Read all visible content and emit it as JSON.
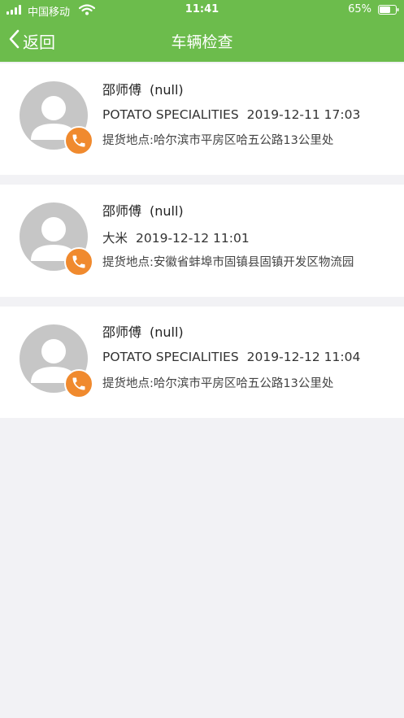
{
  "status_bar": {
    "carrier": "中国移动",
    "time": "11:41",
    "battery": "65%"
  },
  "header": {
    "back_label": "返回",
    "title": "车辆检查"
  },
  "colors": {
    "header_bg": "#6cbc4c",
    "phone_badge": "#f08a2e",
    "avatar_bg": "#c6c6c6",
    "page_bg": "#f2f2f5"
  },
  "records": [
    {
      "driver": "邵师傅",
      "phone": "(null)",
      "goods": "POTATO SPECIALITIES",
      "datetime": "2019-12-11 17:03",
      "pickup": "提货地点:哈尔滨市平房区哈五公路13公里处"
    },
    {
      "driver": "邵师傅",
      "phone": "(null)",
      "goods": "大米",
      "datetime": "2019-12-12 11:01",
      "pickup": "提货地点:安徽省蚌埠市固镇县固镇开发区物流园"
    },
    {
      "driver": "邵师傅",
      "phone": "(null)",
      "goods": "POTATO SPECIALITIES",
      "datetime": "2019-12-12 11:04",
      "pickup": "提货地点:哈尔滨市平房区哈五公路13公里处"
    }
  ]
}
